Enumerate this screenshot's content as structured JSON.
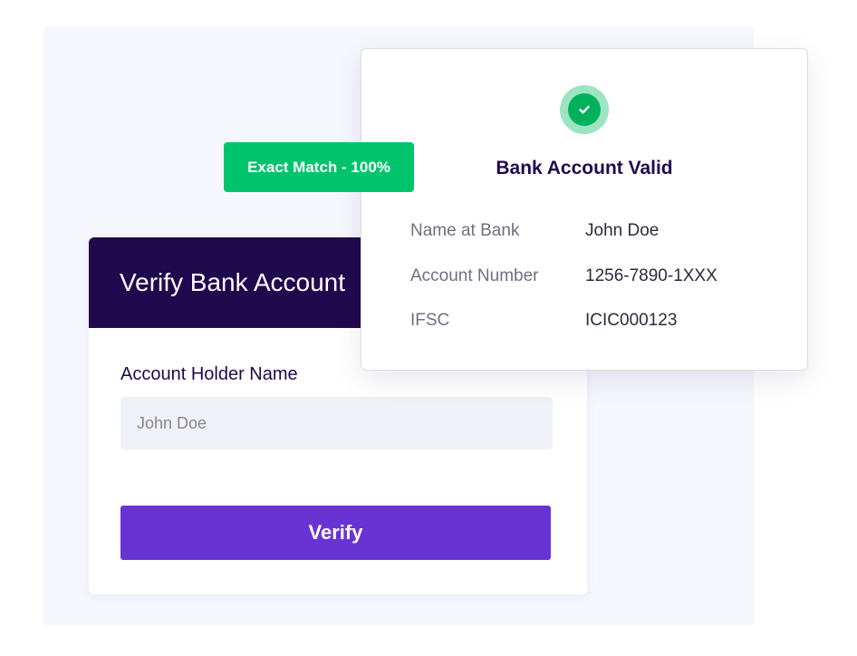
{
  "form": {
    "title": "Verify Bank Account",
    "field_label": "Account Holder Name",
    "field_placeholder": "John Doe",
    "verify_label": "Verify"
  },
  "badge": {
    "text": "Exact Match - 100%",
    "color": "#00c46c"
  },
  "result": {
    "icon": "check-circle-icon",
    "title": "Bank Account Valid",
    "details": [
      {
        "label": "Name at Bank",
        "value": "John Doe"
      },
      {
        "label": "Account Number",
        "value": "1256-7890-1XXX"
      },
      {
        "label": "IFSC",
        "value": "ICIC000123"
      }
    ]
  },
  "colors": {
    "header": "#21094e",
    "button": "#6933d3",
    "success": "#00b15c"
  }
}
